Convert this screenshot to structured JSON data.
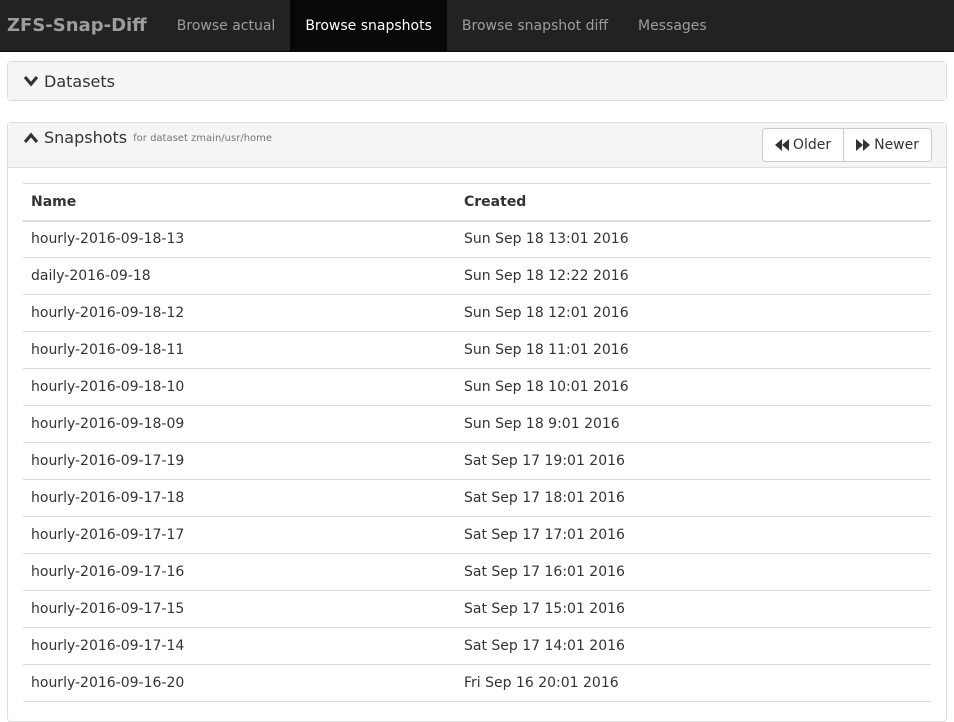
{
  "navbar": {
    "brand": "ZFS-Snap-Diff",
    "items": [
      {
        "label": "Browse actual",
        "active": false
      },
      {
        "label": "Browse snapshots",
        "active": true
      },
      {
        "label": "Browse snapshot diff",
        "active": false
      },
      {
        "label": "Messages",
        "active": false
      }
    ]
  },
  "datasets_panel": {
    "title": "Datasets",
    "icon": "chevron-down-icon"
  },
  "snapshots_panel": {
    "title": "Snapshots",
    "subtitle": "for dataset zmain/usr/home",
    "icon": "chevron-up-icon",
    "older_label": "Older",
    "newer_label": "Newer",
    "columns": [
      "Name",
      "Created"
    ],
    "rows": [
      {
        "name": "hourly-2016-09-18-13",
        "created": "Sun Sep 18 13:01 2016"
      },
      {
        "name": "daily-2016-09-18",
        "created": "Sun Sep 18 12:22 2016"
      },
      {
        "name": "hourly-2016-09-18-12",
        "created": "Sun Sep 18 12:01 2016"
      },
      {
        "name": "hourly-2016-09-18-11",
        "created": "Sun Sep 18 11:01 2016"
      },
      {
        "name": "hourly-2016-09-18-10",
        "created": "Sun Sep 18 10:01 2016"
      },
      {
        "name": "hourly-2016-09-18-09",
        "created": "Sun Sep 18 9:01 2016"
      },
      {
        "name": "hourly-2016-09-17-19",
        "created": "Sat Sep 17 19:01 2016"
      },
      {
        "name": "hourly-2016-09-17-18",
        "created": "Sat Sep 17 18:01 2016"
      },
      {
        "name": "hourly-2016-09-17-17",
        "created": "Sat Sep 17 17:01 2016"
      },
      {
        "name": "hourly-2016-09-17-16",
        "created": "Sat Sep 17 16:01 2016"
      },
      {
        "name": "hourly-2016-09-17-15",
        "created": "Sat Sep 17 15:01 2016"
      },
      {
        "name": "hourly-2016-09-17-14",
        "created": "Sat Sep 17 14:01 2016"
      },
      {
        "name": "hourly-2016-09-16-20",
        "created": "Fri Sep 16 20:01 2016"
      }
    ]
  }
}
